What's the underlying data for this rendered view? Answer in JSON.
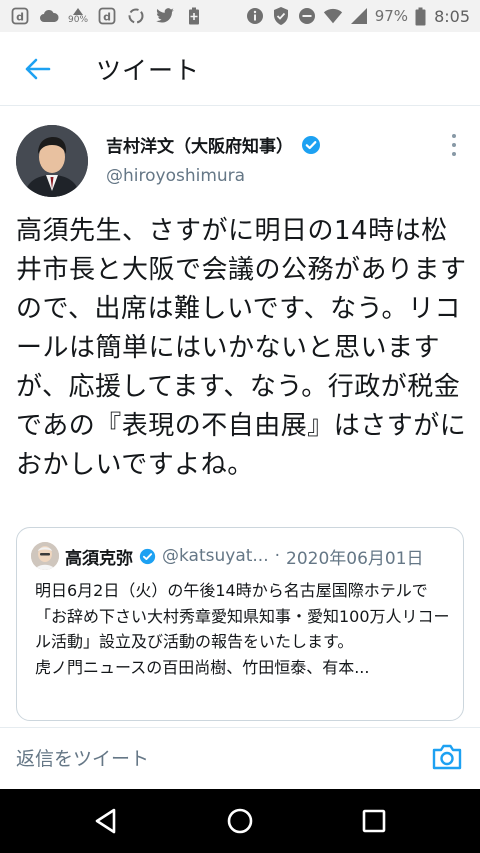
{
  "status_bar": {
    "battery_percent": "97%",
    "time": "8:05",
    "small_label": "90%",
    "icons": [
      "d-icon",
      "cloud-icon",
      "percent-icon",
      "d-icon",
      "recycle-icon",
      "twitter-bird-icon",
      "battery-plus-icon",
      "info-icon",
      "shield-icon",
      "dnd-icon",
      "wifi-icon",
      "signal-icon",
      "battery-icon"
    ]
  },
  "header": {
    "title": "ツイート"
  },
  "tweet": {
    "author": {
      "display_name": "吉村洋文（大阪府知事）",
      "handle": "@hiroyoshimura",
      "verified": true
    },
    "body": "高須先生、さすがに明日の14時は松井市長と大阪で会議の公務がありますので、出席は難しいです、なう。リコールは簡単にはいかないと思いますが、応援してます、なう。行政が税金であの『表現の不自由展』はさすがにおかしいですよね。",
    "quoted": {
      "display_name": "高須克弥",
      "handle": "@katsuyat...",
      "separator": "·",
      "date": "2020年06月01日",
      "verified": true,
      "text_main": "明日6月2日（火）の午後14時から名古屋国際ホテルで「お辞め下さい大村秀章愛知県知事・愛知100万人リコール活動」設立及び活動の報告をいたします。",
      "text_last": "虎ノ門ニュースの百田尚樹、竹田恒泰、有本..."
    }
  },
  "reply": {
    "placeholder": "返信をツイート"
  },
  "colors": {
    "accent": "#1da1f2",
    "text": "#14171a",
    "muted": "#657786",
    "border": "#ccd6dd"
  }
}
